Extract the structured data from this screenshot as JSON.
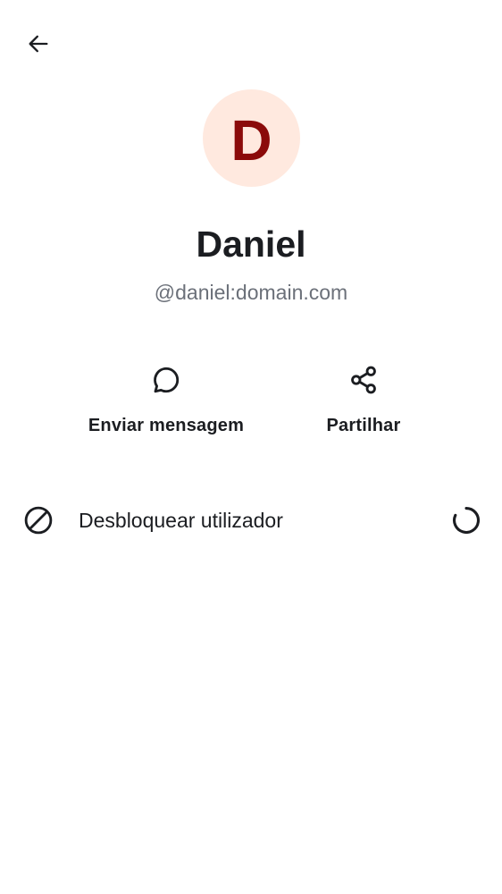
{
  "header": {
    "back_icon": "arrow-left-icon"
  },
  "profile": {
    "avatar_initial": "D",
    "avatar_bg": "#ffe9df",
    "avatar_fg": "#8b0a0a",
    "display_name": "Daniel",
    "user_id": "@daniel:domain.com"
  },
  "actions": [
    {
      "label": "Enviar mensagem",
      "icon": "chat-bubble-icon"
    },
    {
      "label": "Partilhar",
      "icon": "share-icon"
    }
  ],
  "unblock": {
    "label": "Desbloquear utilizador",
    "icon": "block-icon",
    "status_icon": "loading-spinner-icon"
  }
}
